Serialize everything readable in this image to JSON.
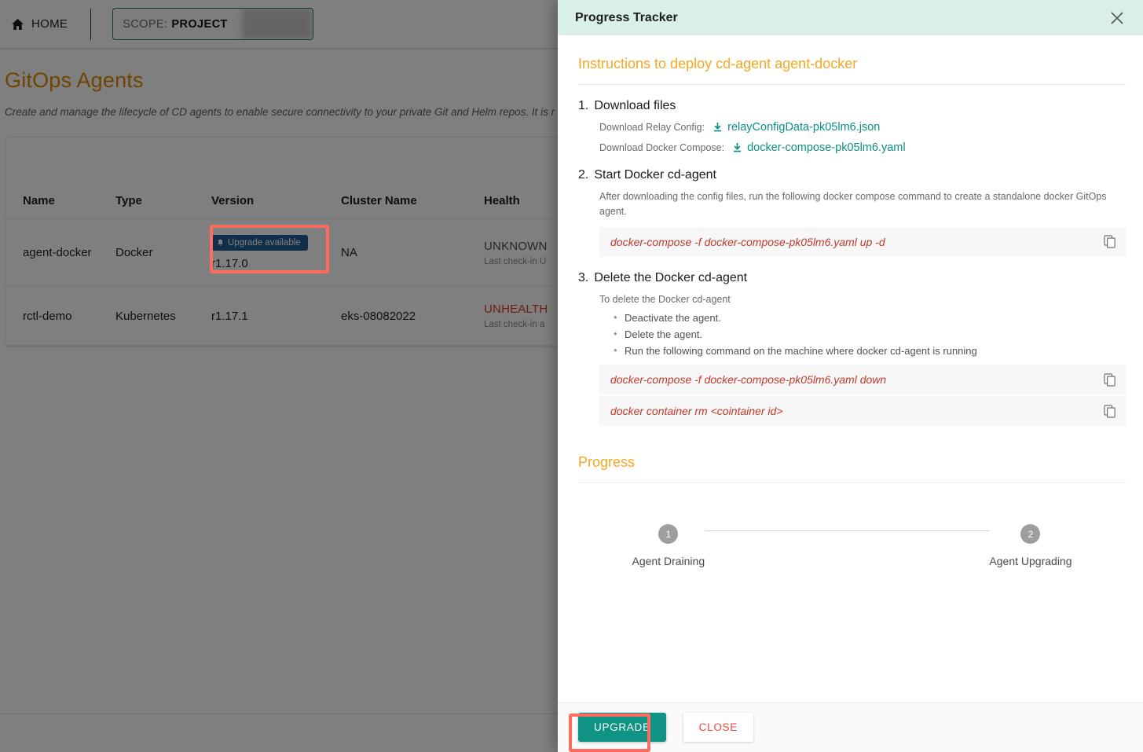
{
  "topbar": {
    "home_label": "HOME",
    "home_icon": "home-icon",
    "scope_label": "SCOPE:",
    "scope_value": "PROJECT"
  },
  "page": {
    "title": "GitOps Agents",
    "description": "Create and manage the lifecycle of CD agents to enable secure connectivity to your private Git and Helm repos. It is r"
  },
  "table": {
    "columns": [
      "Name",
      "Type",
      "Version",
      "Cluster Name",
      "Health"
    ],
    "rows": [
      {
        "name": "agent-docker",
        "type": "Docker",
        "version": "r1.17.0",
        "upgrade_badge": "Upgrade available",
        "cluster": "NA",
        "health": "UNKNOWN",
        "health_state": "unknown",
        "health_sub": "Last check-in  U"
      },
      {
        "name": "rctl-demo",
        "type": "Kubernetes",
        "version": "r1.17.1",
        "upgrade_badge": null,
        "cluster": "eks-08082022",
        "health": "UNHEALTH",
        "health_state": "unhealthy",
        "health_sub": "Last check-in  a"
      }
    ]
  },
  "panel": {
    "title": "Progress Tracker",
    "close_icon": "close-icon",
    "instructions_heading": "Instructions to deploy cd-agent agent-docker",
    "steps": [
      {
        "num": "1.",
        "title": "Download files",
        "downloads": [
          {
            "label": "Download Relay Config:",
            "file": "relayConfigData-pk05lm6.json"
          },
          {
            "label": "Download Docker Compose:",
            "file": "docker-compose-pk05lm6.yaml"
          }
        ]
      },
      {
        "num": "2.",
        "title": "Start Docker cd-agent",
        "description": "After downloading the config files, run the following docker compose command to create a standalone docker GitOps agent.",
        "commands": [
          "docker-compose -f docker-compose-pk05lm6.yaml up -d"
        ]
      },
      {
        "num": "3.",
        "title": "Delete the Docker cd-agent",
        "description": "To delete the Docker cd-agent",
        "bullets": [
          "Deactivate the agent.",
          "Delete the agent.",
          "Run the following command on the machine where docker cd-agent is running"
        ],
        "commands": [
          "docker-compose -f docker-compose-pk05lm6.yaml down",
          "docker container rm <cointainer id>"
        ]
      }
    ],
    "progress": {
      "heading": "Progress",
      "steps": [
        {
          "num": "1",
          "label": "Agent Draining"
        },
        {
          "num": "2",
          "label": "Agent Upgrading"
        }
      ]
    },
    "footer": {
      "upgrade_label": "UPGRADE",
      "close_label": "CLOSE"
    }
  },
  "colors": {
    "panel_header": "#d9f0e9",
    "accent_orange": "#f5a623",
    "title_orange": "#e08900",
    "teal_link": "#0d8f82",
    "code_red": "#c0392b",
    "badge_blue": "#1e5d94",
    "highlight_red": "#ff6b5e",
    "upgrade_green": "#0e9384",
    "close_red": "#e8453c",
    "unhealthy_red": "#d23b2d"
  }
}
